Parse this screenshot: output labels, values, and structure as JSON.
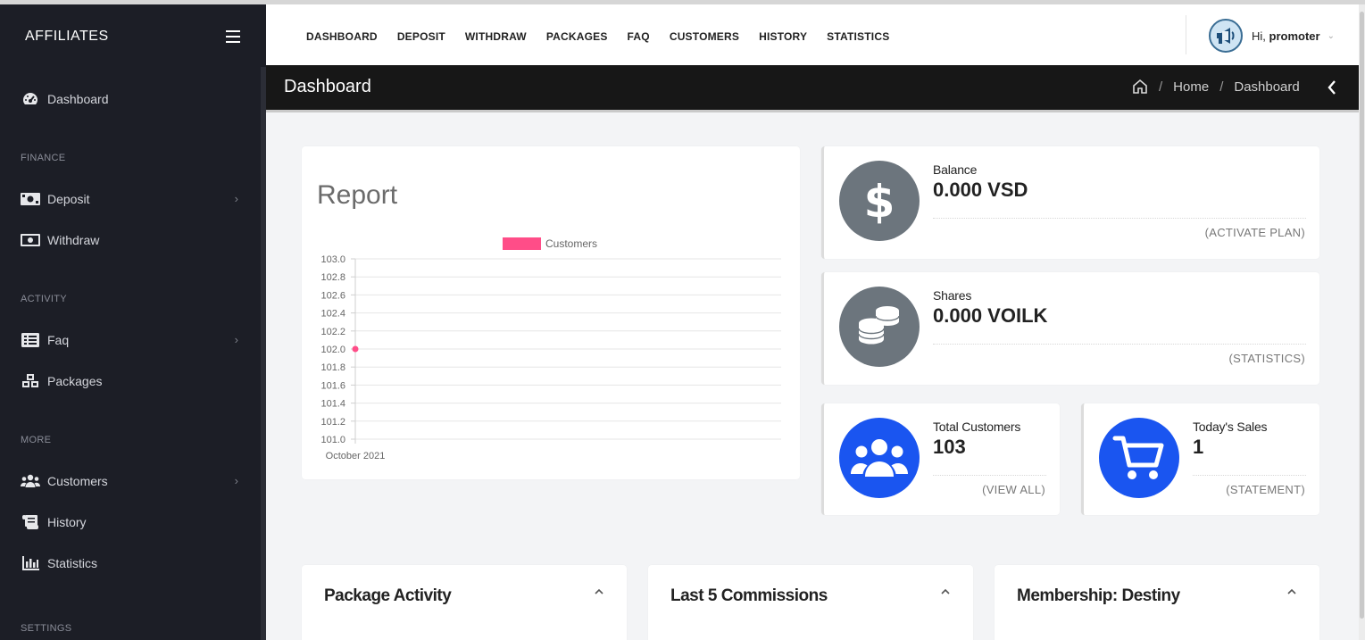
{
  "sidebar": {
    "brand": "AFFILIATES",
    "sections": {
      "finance": "FINANCE",
      "activity": "ACTIVITY",
      "more": "MORE",
      "settings": "SETTINGS"
    },
    "items": [
      {
        "label": "Dashboard",
        "icon": "tachometer-icon"
      },
      {
        "label": "Deposit",
        "icon": "money-bill-icon"
      },
      {
        "label": "Withdraw",
        "icon": "money-bill-alt-icon"
      },
      {
        "label": "Faq",
        "icon": "list-alt-icon"
      },
      {
        "label": "Packages",
        "icon": "cubes-icon"
      },
      {
        "label": "Customers",
        "icon": "users-icon"
      },
      {
        "label": "History",
        "icon": "scroll-icon"
      },
      {
        "label": "Statistics",
        "icon": "chart-bar-icon"
      }
    ]
  },
  "topnav": {
    "links": [
      "DASHBOARD",
      "DEPOSIT",
      "WITHDRAW",
      "PACKAGES",
      "FAQ",
      "CUSTOMERS",
      "HISTORY",
      "STATISTICS"
    ],
    "greeting": "Hi,",
    "username": "promoter"
  },
  "titlebar": {
    "title": "Dashboard",
    "crumb_home": "Home",
    "crumb_current": "Dashboard",
    "separator": "/"
  },
  "report": {
    "title": "Report"
  },
  "chart_data": {
    "type": "line",
    "x": [
      "October 2021"
    ],
    "series": [
      {
        "name": "Customers",
        "values": [
          102.0
        ],
        "color": "#ff4d88"
      }
    ],
    "yticks": [
      "103.0",
      "102.8",
      "102.6",
      "102.4",
      "102.2",
      "102.0",
      "101.8",
      "101.6",
      "101.4",
      "101.2",
      "101.0"
    ],
    "ylim": [
      101.0,
      103.0
    ],
    "xlabel": "",
    "ylabel": "",
    "grid": true,
    "legend": "top-center"
  },
  "stats": {
    "balance": {
      "label": "Balance",
      "value": "0.000 VSD",
      "link": "(ACTIVATE PLAN)",
      "color": "#6c757d"
    },
    "shares": {
      "label": "Shares",
      "value": "0.000 VOILK",
      "link": "(STATISTICS)",
      "color": "#6c757d"
    },
    "customers": {
      "label": "Total Customers",
      "value": "103",
      "link": "(VIEW ALL)",
      "color": "#1a55f0"
    },
    "sales": {
      "label": "Today's Sales",
      "value": "1",
      "link": "(STATEMENT)",
      "color": "#1a55f0"
    }
  },
  "bottom": {
    "package_activity": "Package Activity",
    "last_commissions": "Last 5 Commissions",
    "membership": "Membership: Destiny"
  }
}
